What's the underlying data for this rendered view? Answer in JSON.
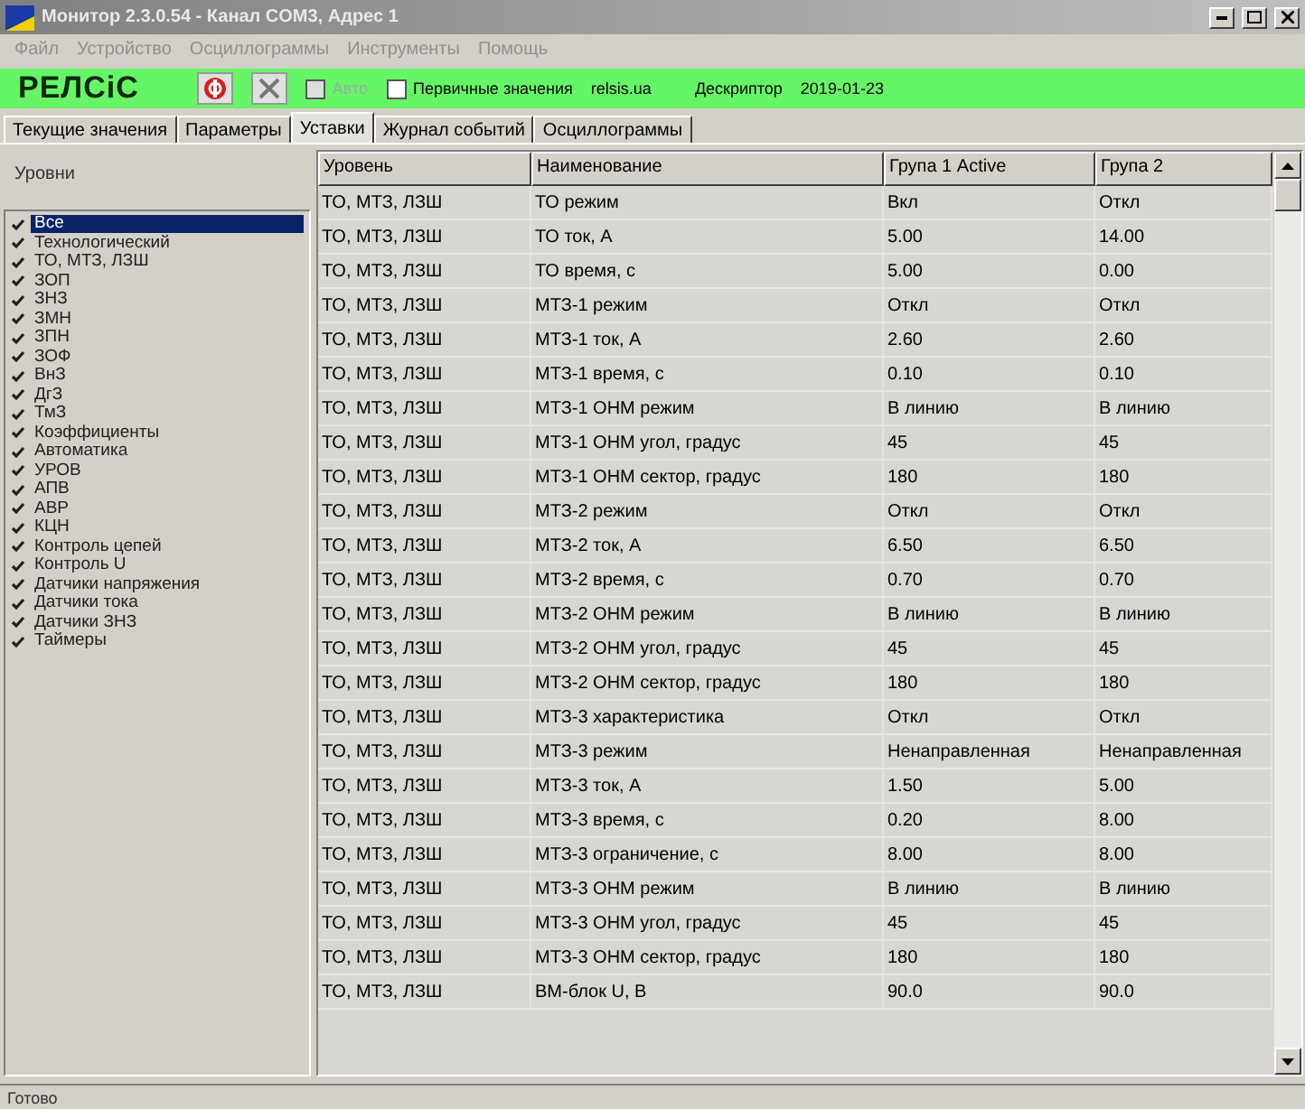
{
  "window": {
    "title": "Монитор 2.3.0.54 - Канал COM3, Адрес 1"
  },
  "menu": [
    "Файл",
    "Устройство",
    "Осциллограммы",
    "Инструменты",
    "Помощь"
  ],
  "toolbar": {
    "logo": "РЕЛСіС",
    "options": [
      {
        "label": "Авто",
        "checked": false,
        "disabled": true
      },
      {
        "label": "Первичные значения",
        "checked": false,
        "disabled": false
      }
    ],
    "site": "relsis.ua",
    "descriptor_label": "Дескриптор",
    "descriptor": "2019-01-23"
  },
  "tabs": [
    {
      "label": "Текущие значения",
      "selected": false
    },
    {
      "label": "Параметры",
      "selected": false
    },
    {
      "label": "Уставки",
      "selected": true
    },
    {
      "label": "Журнал событий",
      "selected": false
    },
    {
      "label": "Осциллограммы",
      "selected": false
    }
  ],
  "sidebar": {
    "title": "Уровни",
    "items": [
      {
        "label": "Все",
        "checked": true,
        "selected": true
      },
      {
        "label": "Технологический",
        "checked": true,
        "selected": false
      },
      {
        "label": "ТО, МТЗ, ЛЗШ",
        "checked": true,
        "selected": false
      },
      {
        "label": "ЗОП",
        "checked": true,
        "selected": false
      },
      {
        "label": "ЗНЗ",
        "checked": true,
        "selected": false
      },
      {
        "label": "ЗМН",
        "checked": true,
        "selected": false
      },
      {
        "label": "ЗПН",
        "checked": true,
        "selected": false
      },
      {
        "label": "ЗОФ",
        "checked": true,
        "selected": false
      },
      {
        "label": "ВнЗ",
        "checked": true,
        "selected": false
      },
      {
        "label": "ДгЗ",
        "checked": true,
        "selected": false
      },
      {
        "label": "ТмЗ",
        "checked": true,
        "selected": false
      },
      {
        "label": "Коэффициенты",
        "checked": true,
        "selected": false
      },
      {
        "label": "Автоматика",
        "checked": true,
        "selected": false
      },
      {
        "label": "УРОВ",
        "checked": true,
        "selected": false
      },
      {
        "label": "АПВ",
        "checked": true,
        "selected": false
      },
      {
        "label": "АВР",
        "checked": true,
        "selected": false
      },
      {
        "label": "КЦН",
        "checked": true,
        "selected": false
      },
      {
        "label": "Контроль цепей",
        "checked": true,
        "selected": false
      },
      {
        "label": "Контроль U",
        "checked": true,
        "selected": false
      },
      {
        "label": "Датчики напряжения",
        "checked": true,
        "selected": false
      },
      {
        "label": "Датчики тока",
        "checked": true,
        "selected": false
      },
      {
        "label": "Датчики ЗНЗ",
        "checked": true,
        "selected": false
      },
      {
        "label": "Таймеры",
        "checked": true,
        "selected": false
      }
    ]
  },
  "table": {
    "columns": [
      "Уровень",
      "Наименование",
      "Група 1 Active",
      "Група 2"
    ],
    "rows": [
      [
        "ТО, МТЗ, ЛЗШ",
        "ТО режим",
        "Вкл",
        "Откл"
      ],
      [
        "ТО, МТЗ, ЛЗШ",
        "ТО ток, А",
        "5.00",
        "14.00"
      ],
      [
        "ТО, МТЗ, ЛЗШ",
        "ТО время, с",
        "5.00",
        "0.00"
      ],
      [
        "ТО, МТЗ, ЛЗШ",
        "МТЗ-1 режим",
        "Откл",
        "Откл"
      ],
      [
        "ТО, МТЗ, ЛЗШ",
        "МТЗ-1 ток, А",
        "2.60",
        "2.60"
      ],
      [
        "ТО, МТЗ, ЛЗШ",
        "МТЗ-1 время, с",
        "0.10",
        "0.10"
      ],
      [
        "ТО, МТЗ, ЛЗШ",
        "МТЗ-1 ОНМ режим",
        "В линию",
        "В линию"
      ],
      [
        "ТО, МТЗ, ЛЗШ",
        "МТЗ-1 ОНМ угол, градус",
        "45",
        "45"
      ],
      [
        "ТО, МТЗ, ЛЗШ",
        "МТЗ-1 ОНМ сектор, градус",
        "180",
        "180"
      ],
      [
        "ТО, МТЗ, ЛЗШ",
        "МТЗ-2 режим",
        "Откл",
        "Откл"
      ],
      [
        "ТО, МТЗ, ЛЗШ",
        "МТЗ-2 ток, А",
        "6.50",
        "6.50"
      ],
      [
        "ТО, МТЗ, ЛЗШ",
        "МТЗ-2 время, с",
        "0.70",
        "0.70"
      ],
      [
        "ТО, МТЗ, ЛЗШ",
        "МТЗ-2 ОНМ режим",
        "В линию",
        "В линию"
      ],
      [
        "ТО, МТЗ, ЛЗШ",
        "МТЗ-2 ОНМ угол, градус",
        "45",
        "45"
      ],
      [
        "ТО, МТЗ, ЛЗШ",
        "МТЗ-2 ОНМ сектор, градус",
        "180",
        "180"
      ],
      [
        "ТО, МТЗ, ЛЗШ",
        "МТЗ-3 характеристика",
        "Откл",
        "Откл"
      ],
      [
        "ТО, МТЗ, ЛЗШ",
        "МТЗ-3 режим",
        "Ненаправленная",
        "Ненаправленная"
      ],
      [
        "ТО, МТЗ, ЛЗШ",
        "МТЗ-3 ток, А",
        "1.50",
        "5.00"
      ],
      [
        "ТО, МТЗ, ЛЗШ",
        "МТЗ-3 время, с",
        "0.20",
        "8.00"
      ],
      [
        "ТО, МТЗ, ЛЗШ",
        "МТЗ-3 ограничение, с",
        "8.00",
        "8.00"
      ],
      [
        "ТО, МТЗ, ЛЗШ",
        "МТЗ-3 ОНМ режим",
        "В линию",
        "В линию"
      ],
      [
        "ТО, МТЗ, ЛЗШ",
        "МТЗ-3 ОНМ угол, градус",
        "45",
        "45"
      ],
      [
        "ТО, МТЗ, ЛЗШ",
        "МТЗ-3 ОНМ сектор, градус",
        "180",
        "180"
      ],
      [
        "ТО, МТЗ, ЛЗШ",
        "ВМ-блок U, В",
        "90.0",
        "90.0"
      ]
    ]
  },
  "status_bar": "Готово"
}
